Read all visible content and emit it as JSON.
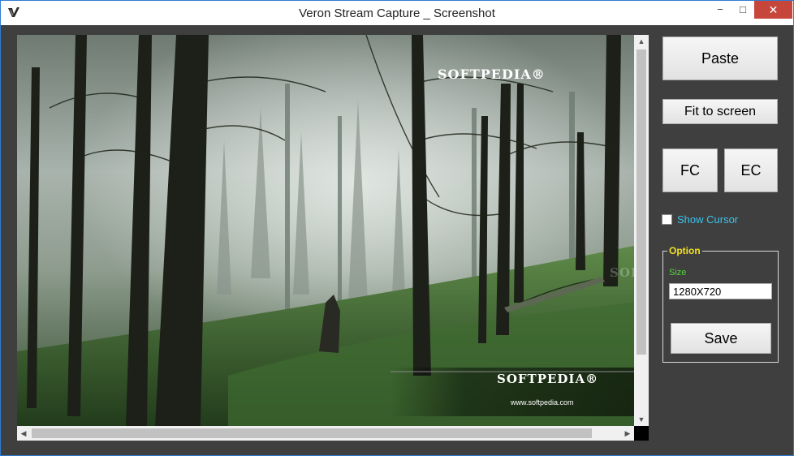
{
  "window": {
    "title": "Veron Stream Capture _ Screenshot",
    "controls": {
      "minimize": "−",
      "maximize": "□",
      "close": "✕"
    },
    "app_icon": "veron-logo-icon"
  },
  "viewer": {
    "watermarks": {
      "top": "SOFTPEDIA®",
      "bottom": "SOFTPEDIA®",
      "url": "www.softpedia.com",
      "side": "SOFTPEDIA™"
    },
    "scroll_arrows": {
      "up": "▲",
      "down": "▼",
      "left": "◀",
      "right": "▶"
    }
  },
  "controls": {
    "paste_label": "Paste",
    "fit_label": "Fit to screen",
    "fc_label": "FC",
    "ec_label": "EC",
    "show_cursor_label": "Show Cursor",
    "show_cursor_checked": false
  },
  "option": {
    "title": "Option",
    "size_label": "Size",
    "size_value": "1280X720",
    "save_label": "Save"
  },
  "colors": {
    "window_bg": "#3f3f3f",
    "close_red": "#c7463c",
    "show_cursor_text": "#39c4ee",
    "option_title": "#f0e020",
    "size_label": "#54d63a"
  }
}
